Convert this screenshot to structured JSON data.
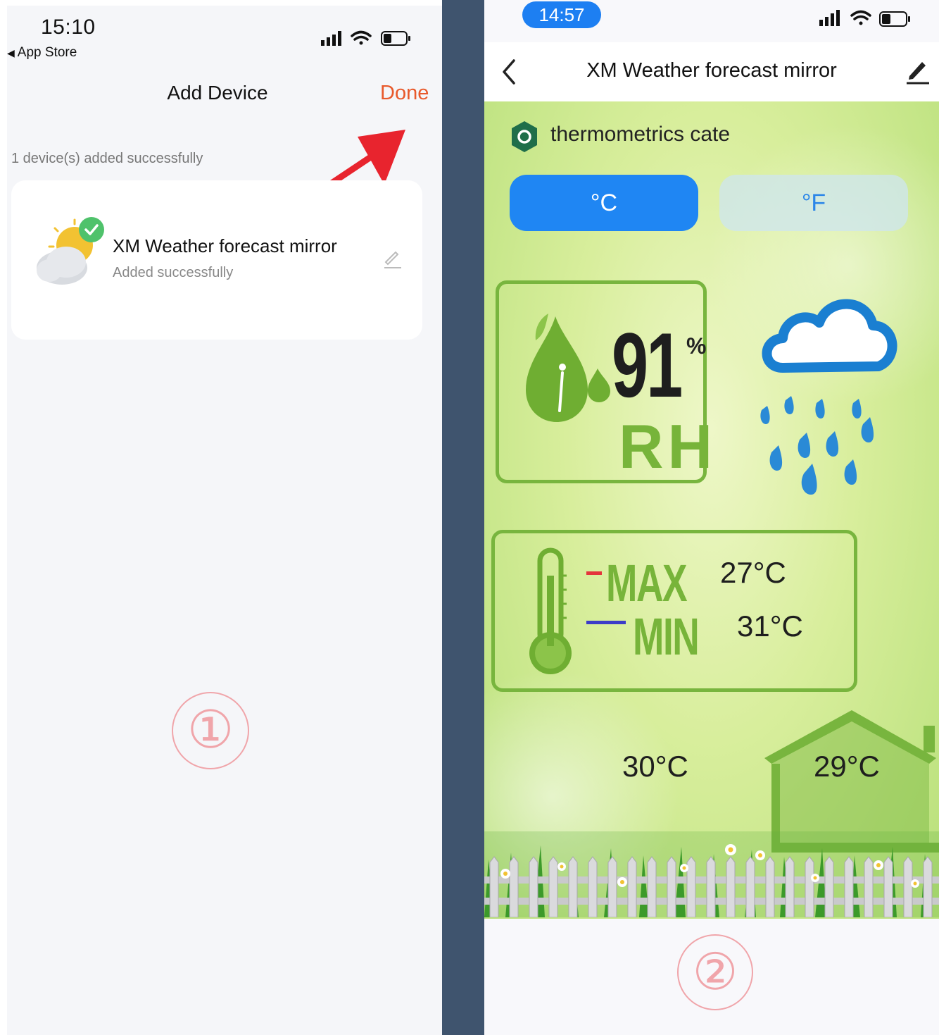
{
  "left": {
    "status_time": "15:10",
    "back_app_label": "App Store",
    "nav_title": "Add Device",
    "done_label": "Done",
    "added_count_text": "1 device(s) added successfully",
    "device": {
      "name": "XM Weather forecast mirror",
      "status": "Added successfully",
      "icon": "sun-cloud-check-icon"
    },
    "step_label": "①"
  },
  "right": {
    "status_time": "14:57",
    "nav_title": "XM Weather forecast mirror",
    "sensor_name": "thermometrics  cate",
    "units": {
      "celsius": "°C",
      "fahrenheit": "°F",
      "selected": "°C"
    },
    "humidity": {
      "value": "91",
      "unit": "%",
      "label": "RH"
    },
    "weather_icon": "rain-cloud-icon",
    "temperature": {
      "max_label": "MAX",
      "min_label": "MIN",
      "max_value": "27°C",
      "min_value": "31°C"
    },
    "outdoor_temp": "30°C",
    "indoor_temp": "29°C",
    "step_label": "②"
  },
  "colors": {
    "accent_orange": "#e8592b",
    "accent_blue": "#1f86f3",
    "leaf_green": "#78b53e",
    "arrow_red": "#e8242e",
    "divider": "#3f546e",
    "max_red": "#e4343c",
    "min_blue": "#3c3cc8"
  }
}
